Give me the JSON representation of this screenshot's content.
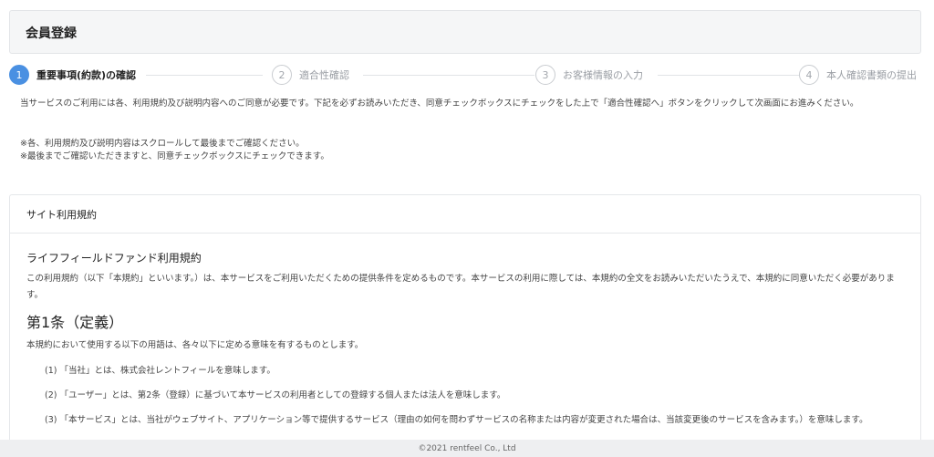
{
  "header": {
    "title": "会員登録"
  },
  "steps": [
    {
      "num": "1",
      "label": "重要事項(約款)の確認"
    },
    {
      "num": "2",
      "label": "適合性確認"
    },
    {
      "num": "3",
      "label": "お客様情報の入力"
    },
    {
      "num": "4",
      "label": "本人確認書類の提出"
    }
  ],
  "intro": {
    "text": "当サービスのご利用には各、利用規約及び説明内容へのご同意が必要です。下記を必ずお読みいただき、同意チェックボックスにチェックをした上で「適合性確認へ」ボタンをクリックして次画面にお進みください。",
    "note1": "※各、利用規約及び説明内容はスクロールして最後までご確認ください。",
    "note2": "※最後までご確認いただきますと、同意チェックボックスにチェックできます。"
  },
  "terms": {
    "card_title": "サイト利用規約",
    "doc_title": "ライフフィールドファンド利用規約",
    "lead": "この利用規約（以下「本規約」といいます。）は、本サービスをご利用いただくための提供条件を定めるものです。本サービスの利用に際しては、本規約の全文をお読みいただいたうえで、本規約に同意いただく必要があります。",
    "article1_heading": "第1条（定義）",
    "article1_lead": "本規約において使用する以下の用語は、各々以下に定める意味を有するものとします。",
    "items": [
      "(1) 「当社」とは、株式会社レントフィールを意味します。",
      "(2) 「ユーザー」とは、第2条（登録）に基づいて本サービスの利用者としての登録する個人または法人を意味します。",
      "(3) 「本サービス」とは、当社がウェブサイト、アプリケーション等で提供するサービス（理由の如何を問わずサービスの名称または内容が変更された場合は、当該変更後のサービスを含みます。）を意味します。"
    ]
  },
  "footer": {
    "copyright": "©2021 rentfeel Co., Ltd"
  }
}
